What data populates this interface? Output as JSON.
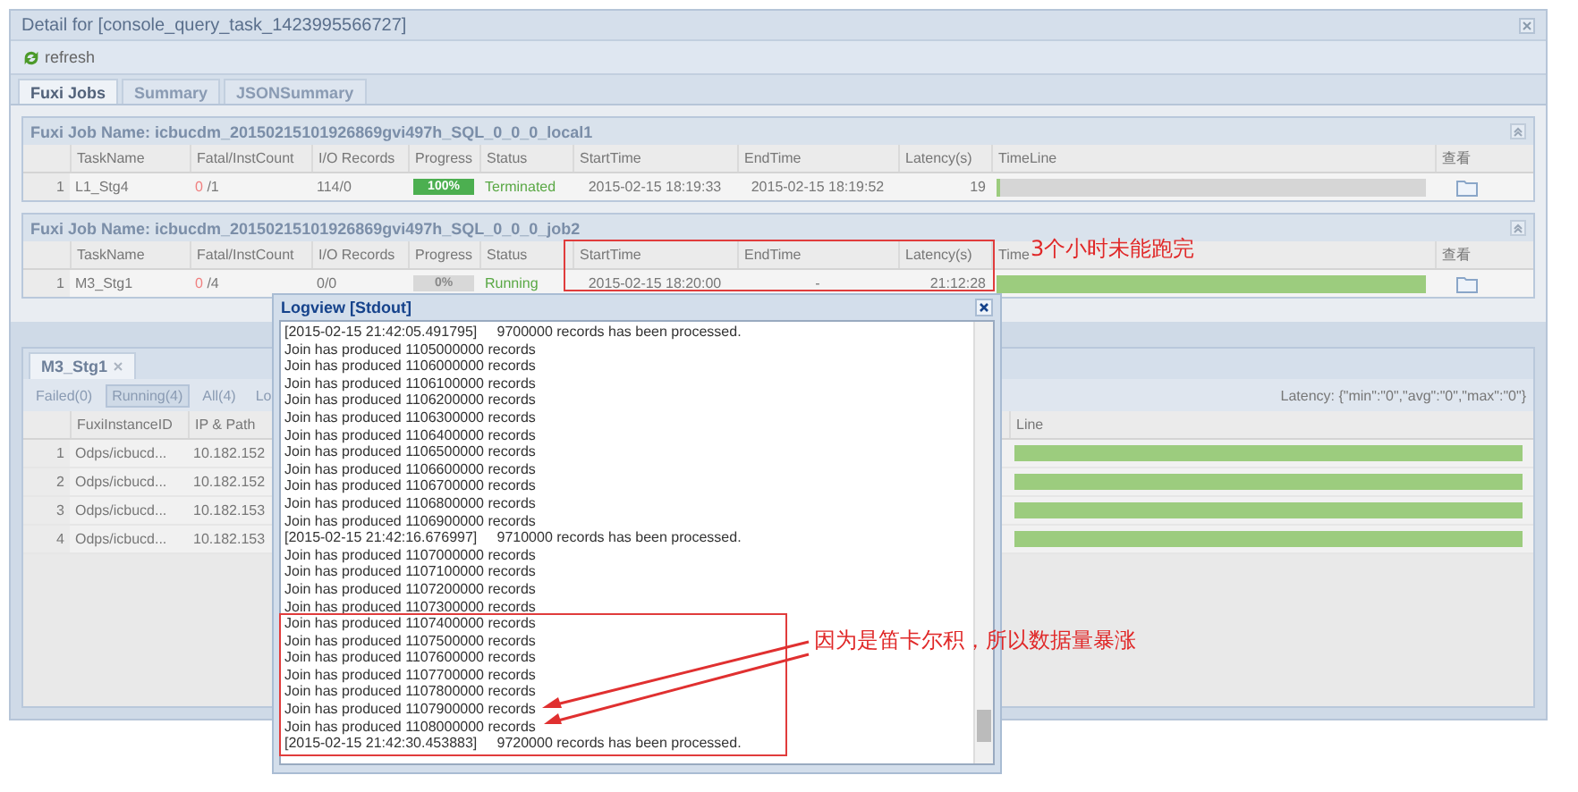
{
  "window": {
    "title": "Detail for [console_query_task_1423995566727]"
  },
  "toolbar": {
    "refresh": "refresh"
  },
  "tabs": [
    {
      "label": "Fuxi Jobs",
      "selected": true
    },
    {
      "label": "Summary",
      "selected": false
    },
    {
      "label": "JSONSummary",
      "selected": false
    }
  ],
  "jobs": [
    {
      "name": "Fuxi Job Name: icbucdm_20150215101926869gvi497h_SQL_0_0_0_local1",
      "columns": [
        "TaskName",
        "Fatal/InstCount",
        "I/O Records",
        "Progress",
        "Status",
        "StartTime",
        "EndTime",
        "Latency(s)",
        "TimeLine",
        "查看"
      ],
      "rows": [
        {
          "index": "1",
          "task": "L1_Stg4",
          "fatal": "0",
          "count": "/1",
          "io": "114/0",
          "progress": "100%",
          "level": 1,
          "status": "Terminated",
          "start": "2015-02-15 18:19:33",
          "end": "2015-02-15 18:19:52",
          "latency": "19",
          "timeline": {
            "level": 0.01
          }
        }
      ]
    },
    {
      "name": "Fuxi Job Name: icbucdm_20150215101926869gvi497h_SQL_0_0_0_job2",
      "columns": [
        "TaskName",
        "Fatal/InstCount",
        "I/O Records",
        "Progress",
        "Status",
        "StartTime",
        "EndTime",
        "Latency(s)",
        "Time",
        "查看"
      ],
      "rows": [
        {
          "index": "1",
          "task": "M3_Stg1",
          "fatal": "0",
          "count": "/4",
          "io": "0/0",
          "progress": "0%",
          "level": 0,
          "status": "Running",
          "start": "2015-02-15 18:20:00",
          "end": "-",
          "latency": "21:12:28",
          "timeline": {
            "level": 1
          }
        }
      ]
    }
  ],
  "instances": {
    "tab": "M3_Stg1",
    "filters": [
      {
        "label": "Failed(0)",
        "selected": false
      },
      {
        "label": "Running(4)",
        "selected": true
      },
      {
        "label": "All(4)",
        "selected": false
      },
      {
        "label": "Lo",
        "selected": false
      }
    ],
    "latency": "Latency: {\"min\":\"0\",\"avg\":\"0\",\"max\":\"0\"}",
    "columns": [
      "FuxiInstanceID",
      "IP & Path",
      "Line"
    ],
    "rows": [
      {
        "index": "1",
        "id": "Odps/icbucd...",
        "ip": "10.182.152",
        "timeline": {
          "level": 1
        }
      },
      {
        "index": "2",
        "id": "Odps/icbucd...",
        "ip": "10.182.152",
        "timeline": {
          "level": 1
        }
      },
      {
        "index": "3",
        "id": "Odps/icbucd...",
        "ip": "10.182.153",
        "timeline": {
          "level": 1
        }
      },
      {
        "index": "4",
        "id": "Odps/icbucd...",
        "ip": "10.182.153",
        "timeline": {
          "level": 1
        }
      }
    ]
  },
  "logview": {
    "title": "Logview [Stdout]",
    "lines": [
      {
        "kind": "stamp",
        "time": "[2015-02-15 21:42:05.491795]",
        "text": "9700000 records has been processed."
      },
      {
        "kind": "plain",
        "text": "Join has produced 1105000000 records"
      },
      {
        "kind": "plain",
        "text": "Join has produced 1106000000 records"
      },
      {
        "kind": "plain",
        "text": "Join has produced 1106100000 records"
      },
      {
        "kind": "plain",
        "text": "Join has produced 1106200000 records"
      },
      {
        "kind": "plain",
        "text": "Join has produced 1106300000 records"
      },
      {
        "kind": "plain",
        "text": "Join has produced 1106400000 records"
      },
      {
        "kind": "plain",
        "text": "Join has produced 1106500000 records"
      },
      {
        "kind": "plain",
        "text": "Join has produced 1106600000 records"
      },
      {
        "kind": "plain",
        "text": "Join has produced 1106700000 records"
      },
      {
        "kind": "plain",
        "text": "Join has produced 1106800000 records"
      },
      {
        "kind": "plain",
        "text": "Join has produced 1106900000 records"
      },
      {
        "kind": "stamp",
        "time": "[2015-02-15 21:42:16.676997]",
        "text": "9710000 records has been processed."
      },
      {
        "kind": "plain",
        "text": "Join has produced 1107000000 records"
      },
      {
        "kind": "plain",
        "text": "Join has produced 1107100000 records"
      },
      {
        "kind": "plain",
        "text": "Join has produced 1107200000 records"
      },
      {
        "kind": "plain",
        "text": "Join has produced 1107300000 records"
      },
      {
        "kind": "plain",
        "text": "Join has produced 1107400000 records"
      },
      {
        "kind": "plain",
        "text": "Join has produced 1107500000 records"
      },
      {
        "kind": "plain",
        "text": "Join has produced 1107600000 records"
      },
      {
        "kind": "plain",
        "text": "Join has produced 1107700000 records"
      },
      {
        "kind": "plain",
        "text": "Join has produced 1107800000 records"
      },
      {
        "kind": "plain",
        "text": "Join has produced 1107900000 records"
      },
      {
        "kind": "plain",
        "text": "Join has produced 1108000000 records"
      },
      {
        "kind": "stamp",
        "time": "[2015-02-15 21:42:30.453883]",
        "text": "9720000 records has been processed."
      }
    ]
  },
  "annotations": [
    {
      "text": "3个小时未能跑完"
    },
    {
      "text": "因为是笛卡尔积，所以数据量暴涨"
    }
  ]
}
